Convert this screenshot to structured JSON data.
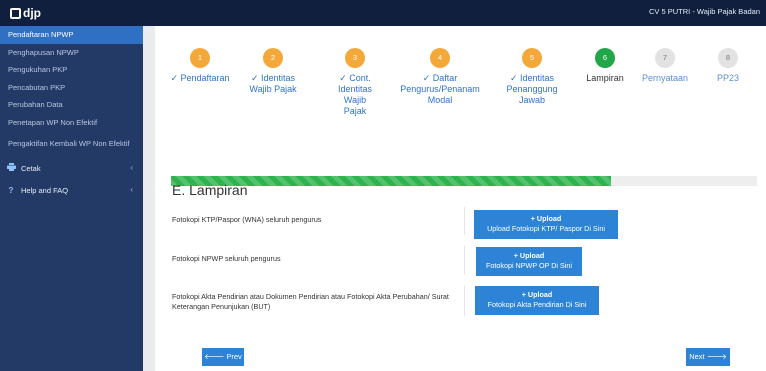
{
  "topbar": {
    "logo_text": "djp",
    "user": "CV 5 PUTRI - Wajib Pajak Badan"
  },
  "sidebar": {
    "items": [
      {
        "label": "Pendaftaran NPWP"
      },
      {
        "label": "Penghapusan NPWP"
      },
      {
        "label": "Pengukuhan PKP"
      },
      {
        "label": "Pencabutan PKP"
      },
      {
        "label": "Perubahan Data"
      },
      {
        "label": "Penetapan WP Non Efektif"
      },
      {
        "label": "Pengaktifan Kembali WP Non Efektif"
      }
    ],
    "groups": [
      {
        "label": "Cetak",
        "icon": "printer-icon"
      },
      {
        "label": "Help and FAQ",
        "icon": "question-icon"
      }
    ],
    "chevron": "‹",
    "question_glyph": "?"
  },
  "stepper": {
    "steps": [
      {
        "num": "1",
        "label": "✓ Pendaftaran",
        "state": "done"
      },
      {
        "num": "2",
        "label": "✓ Identitas Wajib Pajak",
        "state": "done"
      },
      {
        "num": "3",
        "label": "✓ Cont. Identitas Wajib Pajak",
        "state": "done"
      },
      {
        "num": "4",
        "label": "✓ Daftar Pengurus/Penanam Modal",
        "state": "done"
      },
      {
        "num": "5",
        "label": "✓ Identitas Penanggung Jawab",
        "state": "done"
      },
      {
        "num": "6",
        "label": "Lampiran",
        "state": "current"
      },
      {
        "num": "7",
        "label": "Pernyataan",
        "state": "todo"
      },
      {
        "num": "8",
        "label": "PP23",
        "state": "todo"
      }
    ],
    "progress_fraction": 0.75
  },
  "section": {
    "title": "E. Lampiran",
    "rows": [
      {
        "label": "Fotokopi KTP/Paspor (WNA) seluruh pengurus",
        "btn_top": "+ Upload",
        "btn_bottom": "Upload Fotokopi KTP/ Paspor Di Sini"
      },
      {
        "label": "Fotokopi NPWP seluruh pengurus",
        "btn_top": "+ Upload",
        "btn_bottom": "Fotokopi NPWP OP Di Sini"
      },
      {
        "label": "Fotokopi Akta Pendirian atau Dokumen Pendirian atau Fotokopi Akta Perubahan/ Surat Keterangan Penunjukan (BUT)",
        "btn_top": "+ Upload",
        "btn_bottom": "Fotokopi Akta Pendirian Di Sini"
      }
    ]
  },
  "nav": {
    "prev": "🡐 Prev",
    "next": "Next 🡒"
  },
  "colors": {
    "accent": "#2d84d6",
    "done": "#f4a83a",
    "current": "#21a649",
    "sidebar": "#233a66",
    "topbar": "#0f1f3d"
  }
}
